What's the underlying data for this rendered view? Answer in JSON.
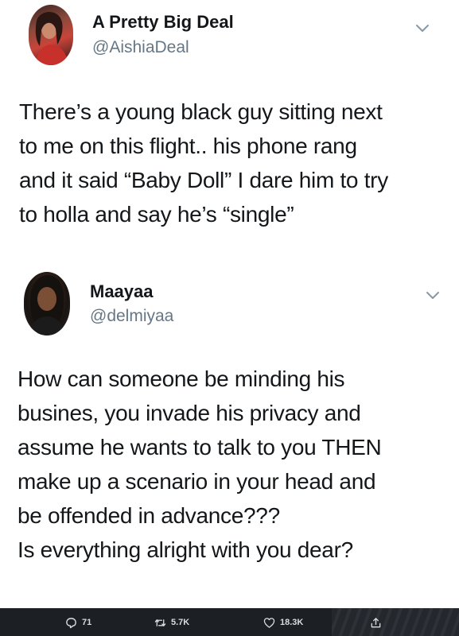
{
  "tweets": [
    {
      "display_name": "A Pretty Big Deal",
      "handle": "@AishiaDeal",
      "avatar_icon": "profile-photo",
      "lines": [
        "There’s a young black guy sitting next",
        "to me on this flight.. his phone rang",
        "and it said “Baby Doll” I dare him to try",
        "to holla and say he’s “single”"
      ]
    },
    {
      "display_name": "Maayaa",
      "handle": "@delmiyaa",
      "avatar_icon": "profile-photo",
      "lines": [
        "How can someone be minding his",
        "busines, you invade his privacy and",
        "assume he wants to talk to you THEN",
        "make up a scenario in your head and",
        "be offended in advance???",
        "Is everything alright with you dear?"
      ]
    }
  ],
  "actions": {
    "reply_count": "71",
    "retweet_count": "5.7K",
    "like_count": "18.3K"
  },
  "colors": {
    "text": "#14171a",
    "secondary": "#657786",
    "action_bar": "#1c1f24"
  }
}
